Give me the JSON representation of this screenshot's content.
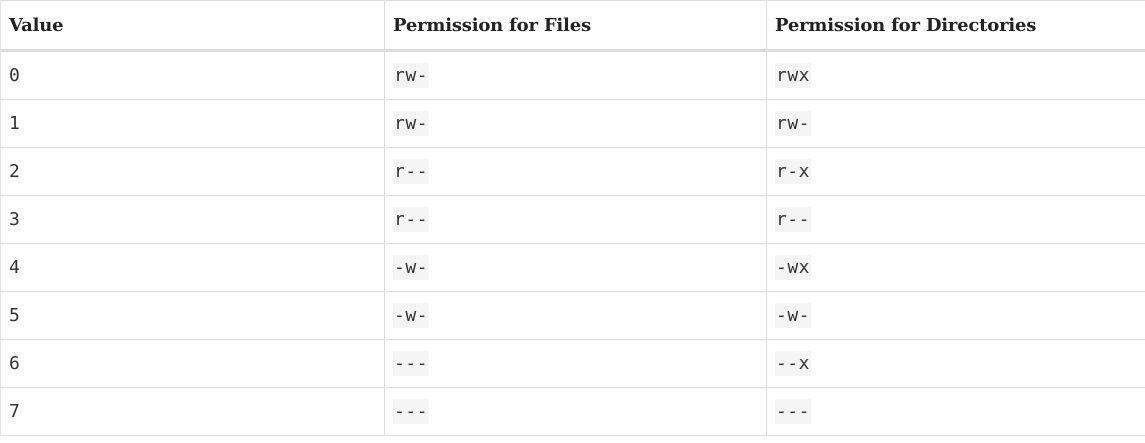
{
  "table": {
    "headers": [
      "Value",
      "Permission for Files",
      "Permission for Directories"
    ],
    "rows": [
      [
        "0",
        "rw-",
        "rwx"
      ],
      [
        "1",
        "rw-",
        "rw-"
      ],
      [
        "2",
        "r--",
        "r-x"
      ],
      [
        "3",
        "r--",
        "r--"
      ],
      [
        "4",
        "-w-",
        "-wx"
      ],
      [
        "5",
        "-w-",
        "-w-"
      ],
      [
        "6",
        "---",
        "--x"
      ],
      [
        "7",
        "---",
        "---"
      ]
    ]
  }
}
